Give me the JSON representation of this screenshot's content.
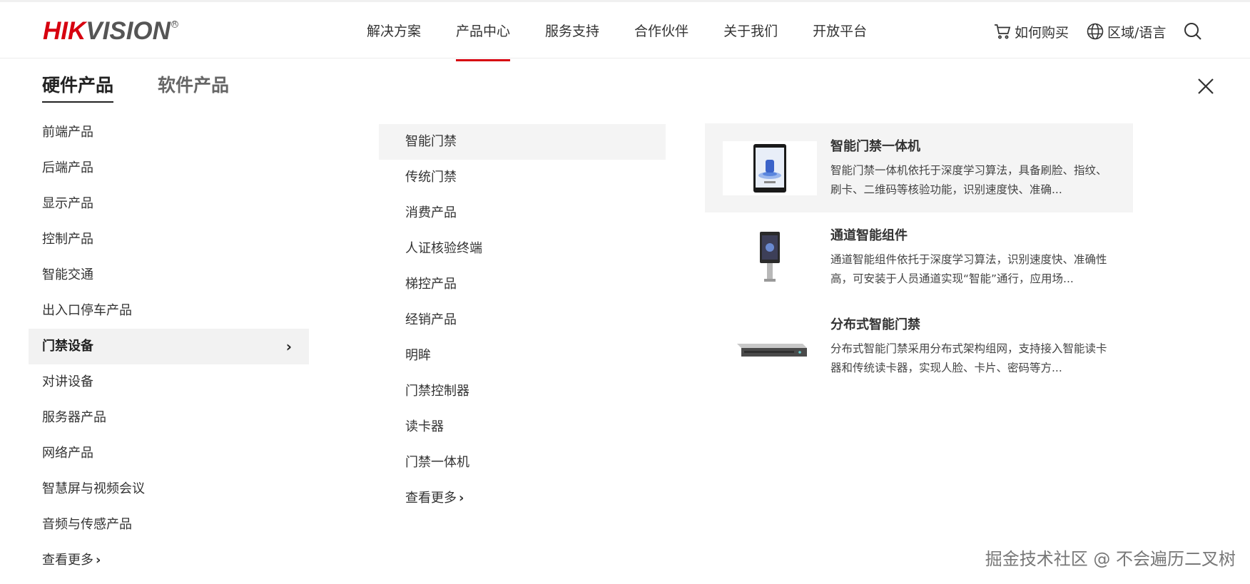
{
  "brand": {
    "logo_red": "HIK",
    "logo_grey": "VISION",
    "logo_reg": "R"
  },
  "nav": {
    "items": [
      {
        "label": "解决方案"
      },
      {
        "label": "产品中心",
        "active": true
      },
      {
        "label": "服务支持"
      },
      {
        "label": "合作伙伴"
      },
      {
        "label": "关于我们"
      },
      {
        "label": "开放平台"
      }
    ],
    "buy_label": "如何购买",
    "region_label": "区域/语言"
  },
  "tabs": [
    {
      "label": "硬件产品",
      "active": true
    },
    {
      "label": "软件产品"
    }
  ],
  "categories": {
    "items": [
      {
        "label": "前端产品"
      },
      {
        "label": "后端产品"
      },
      {
        "label": "显示产品"
      },
      {
        "label": "控制产品"
      },
      {
        "label": "智能交通"
      },
      {
        "label": "出入口停车产品"
      },
      {
        "label": "门禁设备",
        "active": true
      },
      {
        "label": "对讲设备"
      },
      {
        "label": "服务器产品"
      },
      {
        "label": "网络产品"
      },
      {
        "label": "智慧屏与视频会议"
      },
      {
        "label": "音频与传感产品"
      }
    ],
    "more_label": "查看更多",
    "chevron": "›"
  },
  "subcategories": {
    "items": [
      {
        "label": "智能门禁",
        "active": true
      },
      {
        "label": "传统门禁"
      },
      {
        "label": "消费产品"
      },
      {
        "label": "人证核验终端"
      },
      {
        "label": "梯控产品"
      },
      {
        "label": "经销产品"
      },
      {
        "label": "明眸"
      },
      {
        "label": "门禁控制器"
      },
      {
        "label": "读卡器"
      },
      {
        "label": "门禁一体机"
      }
    ],
    "more_label": "查看更多",
    "chevron": "›"
  },
  "products": [
    {
      "title": "智能门禁一体机",
      "desc": "智能门禁一体机依托于深度学习算法，具备刷脸、指纹、刷卡、二维码等核验功能，识别速度快、准确...",
      "active": true
    },
    {
      "title": "通道智能组件",
      "desc": "通道智能组件依托于深度学习算法，识别速度快、准确性高，可安装于人员通道实现“智能”通行，应用场..."
    },
    {
      "title": "分布式智能门禁",
      "desc": "分布式智能门禁采用分布式架构组网，支持接入智能读卡器和传统读卡器，实现人脸、卡片、密码等方..."
    }
  ],
  "watermark": "掘金技术社区 @ 不会遍历二叉树",
  "colors": {
    "brand_red": "#d7000f",
    "active_bg": "#f2f2f2",
    "text": "#333333"
  },
  "icons": [
    "cart-icon",
    "globe-icon",
    "search-icon",
    "close-icon",
    "chevron-right-icon"
  ]
}
